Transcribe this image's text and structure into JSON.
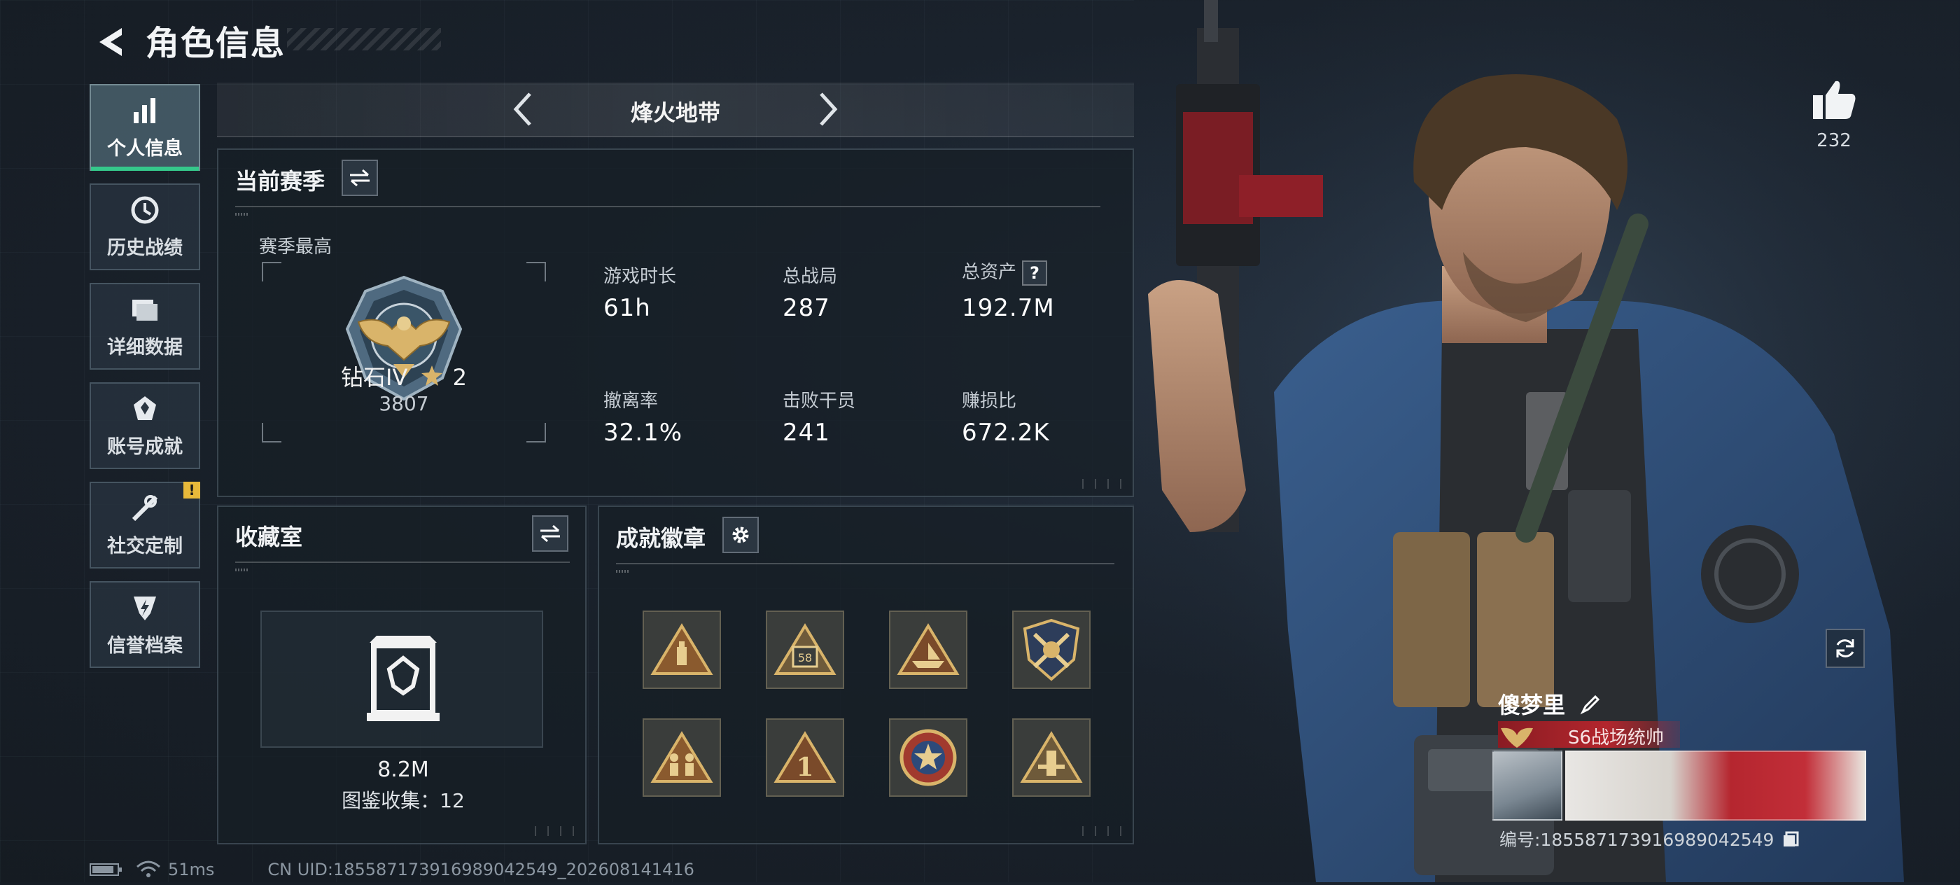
{
  "header": {
    "title": "角色信息"
  },
  "sidebar": {
    "items": [
      {
        "label": "个人信息",
        "icon": "bar-chart-icon",
        "active": true
      },
      {
        "label": "历史战绩",
        "icon": "clock-icon"
      },
      {
        "label": "详细数据",
        "icon": "folder-icon"
      },
      {
        "label": "账号成就",
        "icon": "achievement-icon"
      },
      {
        "label": "社交定制",
        "icon": "tools-icon",
        "alert": "!"
      },
      {
        "label": "信誉档案",
        "icon": "shield-bolt-icon"
      }
    ]
  },
  "mode": {
    "title": "烽火地带"
  },
  "season": {
    "title": "当前赛季",
    "best_label": "赛季最高",
    "rank_name": "钻石IV",
    "rank_stars": "2",
    "rank_points": "3807",
    "stats": [
      {
        "label": "游戏时长",
        "value": "61h"
      },
      {
        "label": "总战局",
        "value": "287"
      },
      {
        "label": "总资产",
        "value": "192.7M",
        "help": "?"
      },
      {
        "label": "撤离率",
        "value": "32.1%"
      },
      {
        "label": "击败干员",
        "value": "241"
      },
      {
        "label": "赚损比",
        "value": "672.2K"
      }
    ]
  },
  "collection": {
    "title": "收藏室",
    "value": "8.2M",
    "catalog_label": "图鉴收集：12"
  },
  "achievements": {
    "title": "成就徽章",
    "badges": [
      "badge-triangle-bottle",
      "badge-triangle-58",
      "badge-triangle-ship",
      "badge-shield-crossed",
      "badge-triangle-soldiers",
      "badge-triangle-1",
      "badge-round-star",
      "badge-triangle-tower"
    ]
  },
  "player": {
    "likes": "232",
    "name": "傻梦里",
    "title_tag": "S6战场统帅",
    "id_text": "编号:185587173916989042549"
  },
  "status": {
    "ping": "51ms",
    "uid": "CN UID:185587173916989042549_202608141416"
  },
  "colors": {
    "accent_green": "#35c88b",
    "gold": "#d9b46a",
    "title_red": "#b3262d"
  }
}
